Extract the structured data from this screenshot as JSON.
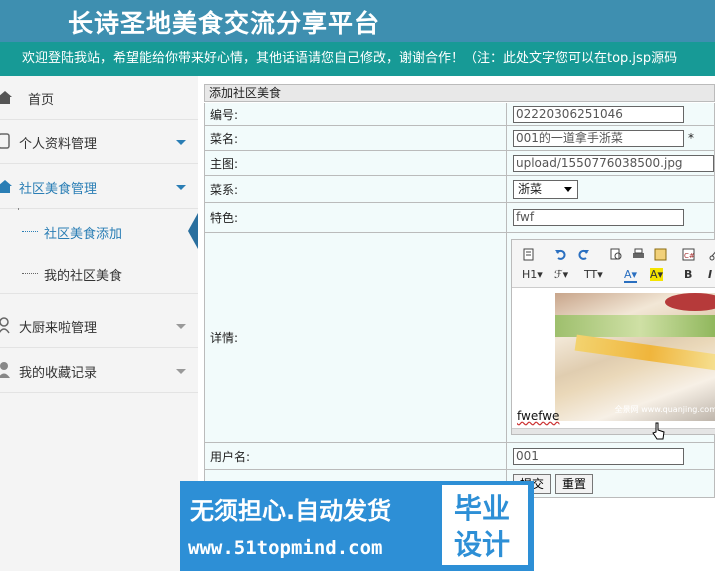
{
  "header": {
    "title": "长诗圣地美食交流分享平台"
  },
  "notice": {
    "text": "欢迎登陆我站，希望能给你带来好心情，其他话语请您自己修改，谢谢合作！（注：此处文字您可以在top.jsp源码"
  },
  "sidebar": {
    "items": [
      {
        "label": "首页",
        "icon": "home-icon"
      },
      {
        "label": "个人资料管理",
        "icon": "user-icon"
      },
      {
        "label": "社区美食管理",
        "icon": "home-icon"
      },
      {
        "label": "大厨来啦管理",
        "icon": "chef-icon"
      },
      {
        "label": "我的收藏记录",
        "icon": "person-icon"
      }
    ],
    "subitems": [
      {
        "label": "社区美食添加"
      },
      {
        "label": "我的社区美食"
      }
    ]
  },
  "form": {
    "caption": "添加社区美食",
    "fields": {
      "id": {
        "label": "编号:",
        "value": "02220306251046"
      },
      "name": {
        "label": "菜名:",
        "value": "001的一道拿手浙菜",
        "required": "*"
      },
      "image": {
        "label": "主图:",
        "value": "upload/1550776038500.jpg"
      },
      "cuisine": {
        "label": "菜系:",
        "value": "浙菜"
      },
      "feature": {
        "label": "特色:",
        "value": "fwf"
      },
      "detail": {
        "label": "详情:",
        "text": "fwefwe",
        "watermark": "全景网 www.quanjing.com"
      },
      "username": {
        "label": "用户名:",
        "value": "001"
      }
    },
    "submit_label": "提交",
    "reset_label": "重置"
  },
  "editor": {
    "heading_label": "H1",
    "font_label": "ℱ",
    "size_label": "TT",
    "font_color_label": "A",
    "bg_color_label": "A",
    "bold_label": "B",
    "italic_label": "I"
  },
  "banner": {
    "line1": "无须担心.自动发货",
    "line2": "www.51topmind.com",
    "badge1": "毕业",
    "badge2": "设计"
  },
  "colors": {
    "header": "#3e8fb0",
    "notice": "#179a96",
    "accent": "#2a7eb5",
    "banner": "#2d8fd6"
  }
}
